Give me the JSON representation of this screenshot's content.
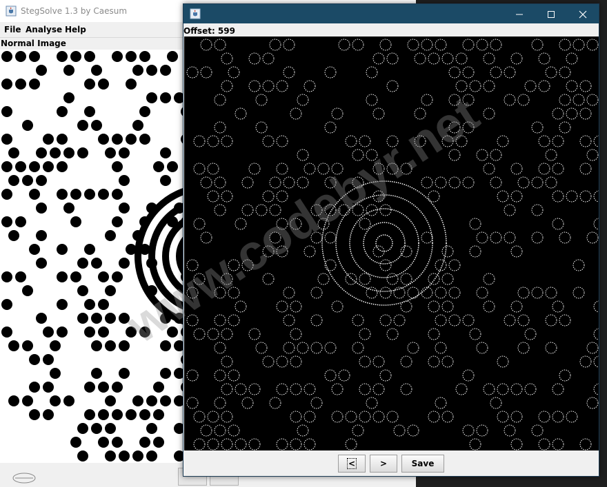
{
  "main_window": {
    "title": "StegSolve 1.3 by Caesum",
    "menu": [
      "File",
      "Analyse",
      "Help"
    ],
    "panel_label": "Normal Image",
    "nav": {
      "prev_label": "<",
      "next_label": ">"
    }
  },
  "viewer_window": {
    "title": "",
    "controls": {
      "minimize": "—",
      "maximize": "☐",
      "close": "✕"
    },
    "offset_label": "Offset: 599",
    "buttons": {
      "prev": "<",
      "next": ">",
      "save": "Save"
    }
  },
  "watermark": "www.codebyr.net",
  "colors": {
    "titlebar_active": "#1b4a66",
    "window_bg": "#f0f0f0",
    "image_bg": "#000000"
  },
  "icons": [
    "java-icon",
    "minimize-icon",
    "maximize-icon",
    "close-icon"
  ]
}
